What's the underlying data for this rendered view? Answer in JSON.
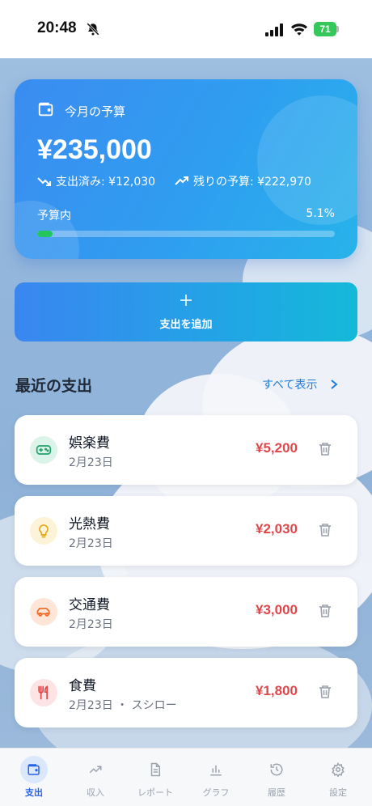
{
  "status_bar": {
    "time": "20:48",
    "battery": "71"
  },
  "budget": {
    "title": "今月の予算",
    "amount": "¥235,000",
    "spent": "支出済み: ¥12,030",
    "remaining": "残りの予算: ¥222,970",
    "status": "予算内",
    "percent_label": "5.1%",
    "percent_value": 5.1
  },
  "actions": {
    "add_label": "支出を追加"
  },
  "recent": {
    "title": "最近の支出",
    "see_all": "すべて表示"
  },
  "expenses": [
    {
      "name": "娯楽費",
      "date": "2月23日",
      "amount": "¥5,200",
      "icon": "gamepad-icon",
      "icon_color": "#22a06b",
      "icon_bg": "#dcf3ea"
    },
    {
      "name": "光熱費",
      "date": "2月23日",
      "amount": "¥2,030",
      "icon": "lightbulb-icon",
      "icon_color": "#e6a817",
      "icon_bg": "#fdf3d8"
    },
    {
      "name": "交通費",
      "date": "2月23日",
      "amount": "¥3,000",
      "icon": "car-icon",
      "icon_color": "#f06a27",
      "icon_bg": "#fde6d8"
    },
    {
      "name": "食費",
      "date": "2月23日 ・ スシロー",
      "amount": "¥1,800",
      "icon": "utensils-icon",
      "icon_color": "#e0464a",
      "icon_bg": "#fde3e3"
    }
  ],
  "tabs": [
    {
      "label": "支出",
      "icon": "wallet-icon",
      "active": true
    },
    {
      "label": "収入",
      "icon": "trend-up-icon",
      "active": false
    },
    {
      "label": "レポート",
      "icon": "document-icon",
      "active": false
    },
    {
      "label": "グラフ",
      "icon": "bar-chart-icon",
      "active": false
    },
    {
      "label": "履歴",
      "icon": "history-icon",
      "active": false
    },
    {
      "label": "設定",
      "icon": "gear-icon",
      "active": false
    }
  ],
  "colors": {
    "accent": "#2563eb",
    "expense_red": "#e0464a",
    "progress_green": "#22c55e"
  }
}
